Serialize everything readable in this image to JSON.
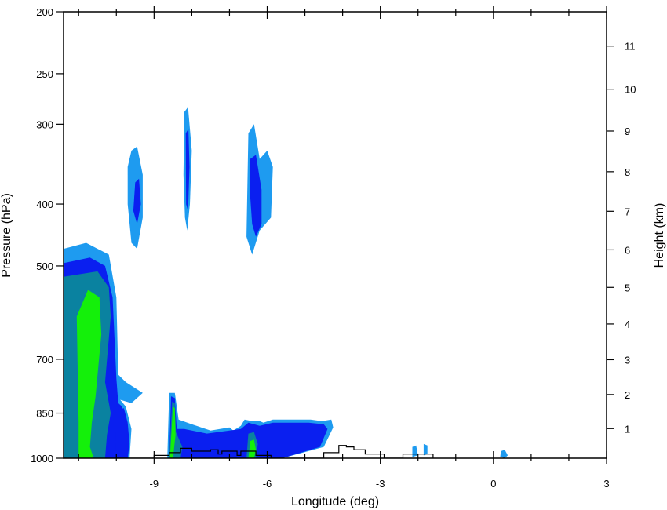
{
  "chart_data": {
    "type": "area",
    "xlabel": "Longitude (deg)",
    "ylabel": "Pressure (hPa)",
    "y2label": "Height (km)",
    "xlim": [
      -11.4,
      3
    ],
    "ylim": [
      1000,
      200
    ],
    "y_scale": "log",
    "x_ticks": [
      -9,
      -6,
      -3,
      0,
      3
    ],
    "x_tick_labels": [
      "-9",
      "-6",
      "-3",
      "0",
      "3"
    ],
    "y_ticks": [
      200,
      250,
      300,
      400,
      500,
      700,
      850,
      1000
    ],
    "y_tick_labels": [
      "200",
      "250",
      "300",
      "400",
      "500",
      "700",
      "850",
      "1000"
    ],
    "y2_ticks": [
      1,
      2,
      3,
      4,
      5,
      6,
      7,
      8,
      9,
      10,
      11
    ],
    "y2_tick_labels": [
      "1",
      "2",
      "3",
      "4",
      "5",
      "6",
      "7",
      "8",
      "9",
      "10",
      "11"
    ],
    "colors": {
      "level1": "#1e9bf0",
      "level2": "#0a1ff0",
      "level3": "#0a82a0",
      "level4": "#14f00a",
      "terrain": "#000000"
    },
    "contour_regions": [
      {
        "level": 1,
        "points": [
          [
            -11.4,
            470
          ],
          [
            -10.8,
            460
          ],
          [
            -10.2,
            480
          ],
          [
            -10.0,
            560
          ],
          [
            -9.95,
            740
          ],
          [
            -9.75,
            760
          ],
          [
            -9.3,
            790
          ],
          [
            -9.6,
            820
          ],
          [
            -9.9,
            810
          ],
          [
            -9.75,
            830
          ],
          [
            -9.6,
            900
          ],
          [
            -9.65,
            1000
          ],
          [
            -11.4,
            1000
          ]
        ]
      },
      {
        "level": 2,
        "points": [
          [
            -11.4,
            495
          ],
          [
            -10.7,
            485
          ],
          [
            -10.3,
            500
          ],
          [
            -10.1,
            560
          ],
          [
            -10.0,
            750
          ],
          [
            -9.95,
            820
          ],
          [
            -9.85,
            830
          ],
          [
            -9.75,
            900
          ],
          [
            -9.8,
            1000
          ],
          [
            -11.4,
            1000
          ]
        ]
      },
      {
        "level": 3,
        "points": [
          [
            -11.4,
            520
          ],
          [
            -10.5,
            510
          ],
          [
            -10.2,
            540
          ],
          [
            -10.15,
            600
          ],
          [
            -10.3,
            760
          ],
          [
            -10.15,
            850
          ],
          [
            -10.25,
            920
          ],
          [
            -10.3,
            1000
          ],
          [
            -11.4,
            1000
          ]
        ]
      },
      {
        "level": 4,
        "points": [
          [
            -11.05,
            600
          ],
          [
            -10.75,
            545
          ],
          [
            -10.45,
            560
          ],
          [
            -10.4,
            640
          ],
          [
            -10.55,
            800
          ],
          [
            -10.65,
            880
          ],
          [
            -10.7,
            960
          ],
          [
            -10.6,
            1000
          ],
          [
            -11.0,
            1000
          ],
          [
            -11.0,
            880
          ]
        ]
      },
      {
        "level": 2,
        "points": [
          [
            -10.05,
            840
          ],
          [
            -9.8,
            835
          ],
          [
            -9.7,
            880
          ],
          [
            -9.65,
            950
          ],
          [
            -9.7,
            1000
          ],
          [
            -10.0,
            1000
          ]
        ]
      },
      {
        "level": 1,
        "points": [
          [
            -9.6,
            330
          ],
          [
            -9.45,
            325
          ],
          [
            -9.3,
            360
          ],
          [
            -9.3,
            420
          ],
          [
            -9.45,
            470
          ],
          [
            -9.6,
            460
          ],
          [
            -9.7,
            400
          ],
          [
            -9.7,
            350
          ]
        ]
      },
      {
        "level": 2,
        "points": [
          [
            -9.5,
            370
          ],
          [
            -9.4,
            365
          ],
          [
            -9.35,
            400
          ],
          [
            -9.45,
            430
          ],
          [
            -9.55,
            410
          ]
        ]
      },
      {
        "level": 1,
        "points": [
          [
            -8.2,
            287
          ],
          [
            -8.1,
            282
          ],
          [
            -8.0,
            330
          ],
          [
            -8.05,
            400
          ],
          [
            -8.12,
            440
          ],
          [
            -8.18,
            420
          ],
          [
            -8.22,
            360
          ]
        ]
      },
      {
        "level": 2,
        "points": [
          [
            -8.16,
            310
          ],
          [
            -8.09,
            305
          ],
          [
            -8.06,
            350
          ],
          [
            -8.1,
            410
          ],
          [
            -8.15,
            400
          ]
        ]
      },
      {
        "level": 1,
        "points": [
          [
            -6.5,
            310
          ],
          [
            -6.35,
            300
          ],
          [
            -6.2,
            340
          ],
          [
            -6.0,
            330
          ],
          [
            -5.85,
            350
          ],
          [
            -5.9,
            420
          ],
          [
            -6.2,
            440
          ],
          [
            -6.4,
            480
          ],
          [
            -6.55,
            450
          ]
        ]
      },
      {
        "level": 2,
        "points": [
          [
            -6.45,
            340
          ],
          [
            -6.3,
            335
          ],
          [
            -6.15,
            380
          ],
          [
            -6.15,
            430
          ],
          [
            -6.3,
            450
          ],
          [
            -6.4,
            430
          ],
          [
            -6.45,
            390
          ]
        ]
      },
      {
        "level": 1,
        "points": [
          [
            -8.6,
            790
          ],
          [
            -8.45,
            790
          ],
          [
            -8.35,
            870
          ],
          [
            -8.0,
            885
          ],
          [
            -7.5,
            905
          ],
          [
            -7.0,
            895
          ],
          [
            -6.9,
            905
          ],
          [
            -6.7,
            890
          ],
          [
            -6.6,
            870
          ],
          [
            -6.4,
            875
          ],
          [
            -6.2,
            875
          ],
          [
            -6.1,
            880
          ],
          [
            -5.85,
            870
          ],
          [
            -4.85,
            870
          ],
          [
            -4.55,
            875
          ],
          [
            -4.3,
            870
          ],
          [
            -4.25,
            895
          ],
          [
            -4.5,
            960
          ],
          [
            -5.6,
            1000
          ],
          [
            -8.65,
            1000
          ]
        ]
      },
      {
        "level": 2,
        "points": [
          [
            -8.55,
            800
          ],
          [
            -8.45,
            805
          ],
          [
            -8.4,
            900
          ],
          [
            -8.2,
            900
          ],
          [
            -7.6,
            915
          ],
          [
            -7.0,
            905
          ],
          [
            -6.7,
            900
          ],
          [
            -6.5,
            880
          ],
          [
            -6.2,
            890
          ],
          [
            -5.85,
            880
          ],
          [
            -4.9,
            880
          ],
          [
            -4.5,
            885
          ],
          [
            -4.4,
            900
          ],
          [
            -4.6,
            960
          ],
          [
            -5.6,
            1000
          ],
          [
            -8.6,
            1000
          ]
        ]
      },
      {
        "level": 3,
        "points": [
          [
            -8.52,
            815
          ],
          [
            -8.45,
            820
          ],
          [
            -8.42,
            910
          ],
          [
            -8.25,
            960
          ],
          [
            -8.3,
            1000
          ],
          [
            -8.6,
            1000
          ]
        ]
      },
      {
        "level": 4,
        "points": [
          [
            -8.5,
            830
          ],
          [
            -8.45,
            835
          ],
          [
            -8.43,
            920
          ],
          [
            -8.5,
            1000
          ],
          [
            -8.58,
            1000
          ]
        ]
      },
      {
        "level": 3,
        "points": [
          [
            -6.5,
            915
          ],
          [
            -6.35,
            910
          ],
          [
            -6.25,
            950
          ],
          [
            -6.3,
            1000
          ],
          [
            -6.55,
            1000
          ]
        ]
      },
      {
        "level": 4,
        "points": [
          [
            -6.45,
            940
          ],
          [
            -6.35,
            935
          ],
          [
            -6.3,
            970
          ],
          [
            -6.35,
            1000
          ],
          [
            -6.5,
            1000
          ]
        ]
      },
      {
        "level": 1,
        "points": [
          [
            -2.15,
            960
          ],
          [
            -2.05,
            955
          ],
          [
            -2.0,
            990
          ],
          [
            -2.15,
            995
          ]
        ]
      },
      {
        "level": 1,
        "points": [
          [
            -1.85,
            950
          ],
          [
            -1.75,
            955
          ],
          [
            -1.75,
            985
          ],
          [
            -1.85,
            990
          ]
        ]
      },
      {
        "level": 1,
        "points": [
          [
            0.2,
            975
          ],
          [
            0.3,
            970
          ],
          [
            0.38,
            990
          ],
          [
            0.3,
            1000
          ],
          [
            0.18,
            995
          ]
        ]
      }
    ],
    "terrain": [
      [
        -10.0,
        1000
      ],
      [
        -9.0,
        1000
      ],
      [
        -9.0,
        990
      ],
      [
        -8.6,
        990
      ],
      [
        -8.6,
        980
      ],
      [
        -8.3,
        980
      ],
      [
        -8.3,
        965
      ],
      [
        -8.0,
        965
      ],
      [
        -8.0,
        975
      ],
      [
        -7.5,
        975
      ],
      [
        -7.5,
        970
      ],
      [
        -7.3,
        970
      ],
      [
        -7.3,
        985
      ],
      [
        -7.2,
        985
      ],
      [
        -7.2,
        975
      ],
      [
        -6.8,
        975
      ],
      [
        -6.8,
        990
      ],
      [
        -6.7,
        990
      ],
      [
        -6.7,
        975
      ],
      [
        -6.3,
        975
      ],
      [
        -6.3,
        990
      ],
      [
        -5.9,
        990
      ],
      [
        -5.9,
        1000
      ],
      [
        -4.5,
        1000
      ],
      [
        -4.5,
        980
      ],
      [
        -4.1,
        980
      ],
      [
        -4.1,
        955
      ],
      [
        -3.9,
        955
      ],
      [
        -3.9,
        960
      ],
      [
        -3.7,
        960
      ],
      [
        -3.7,
        970
      ],
      [
        -3.4,
        970
      ],
      [
        -3.4,
        985
      ],
      [
        -2.9,
        985
      ],
      [
        -2.9,
        1000
      ],
      [
        -2.4,
        1000
      ],
      [
        -2.4,
        985
      ],
      [
        -1.6,
        985
      ],
      [
        -1.6,
        1000
      ]
    ]
  }
}
